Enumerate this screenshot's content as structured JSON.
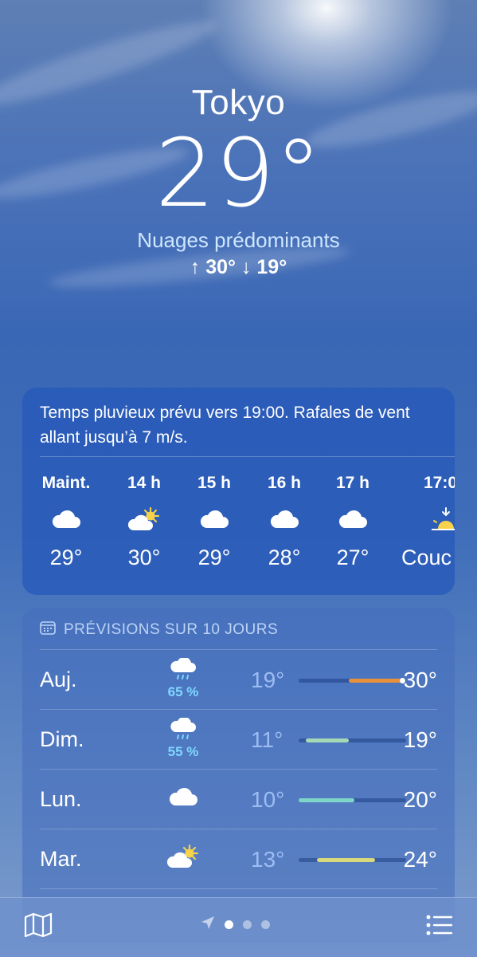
{
  "location": {
    "city": "Tokyo",
    "temperature": "29°",
    "condition": "Nuages prédominants",
    "high_low": "↑ 30°  ↓ 19°"
  },
  "hourly": {
    "summary": "Temps pluvieux prévu vers 19:00. Rafales de vent allant jusqu’à 7 m/s.",
    "items": [
      {
        "time": "Maint.",
        "icon": "cloud-icon",
        "temp": "29°"
      },
      {
        "time": "14 h",
        "icon": "partly-sunny-icon",
        "temp": "30°"
      },
      {
        "time": "15 h",
        "icon": "cloud-icon",
        "temp": "29°"
      },
      {
        "time": "16 h",
        "icon": "cloud-icon",
        "temp": "28°"
      },
      {
        "time": "17 h",
        "icon": "cloud-icon",
        "temp": "27°"
      },
      {
        "time": "17:0",
        "icon": "sunset-icon",
        "temp": "Couc"
      }
    ]
  },
  "forecast": {
    "title": "PRÉVISIONS SUR 10 JOURS",
    "days": [
      {
        "day": "Auj.",
        "icon": "rain-cloud-icon",
        "precip": "65 %",
        "low": "19°",
        "high": "30°",
        "range_start": 0.47,
        "range_end": 0.96,
        "current": 0.96,
        "color": "#e8913a"
      },
      {
        "day": "Dim.",
        "icon": "rain-cloud-icon",
        "precip": "55 %",
        "low": "11°",
        "high": "19°",
        "range_start": 0.07,
        "range_end": 0.47,
        "color": "#a6d9b6"
      },
      {
        "day": "Lun.",
        "icon": "cloud-icon",
        "precip": "",
        "low": "10°",
        "high": "20°",
        "range_start": 0.0,
        "range_end": 0.52,
        "color": "#7fd6c8"
      },
      {
        "day": "Mar.",
        "icon": "partly-sunny-icon",
        "precip": "",
        "low": "13°",
        "high": "24°",
        "range_start": 0.17,
        "range_end": 0.71,
        "color": "#d7d97a"
      }
    ]
  },
  "bottom_bar": {
    "map_icon": "map-icon",
    "list_icon": "list-icon",
    "location_icon": "location-arrow-icon",
    "pages": 3,
    "active_page": 1
  }
}
